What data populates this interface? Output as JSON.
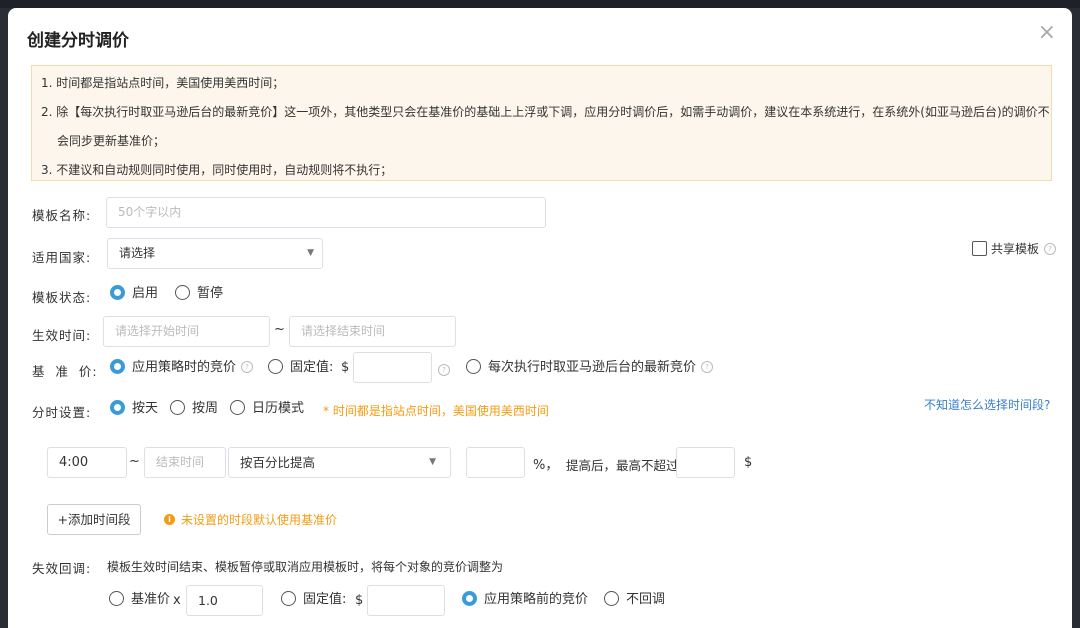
{
  "dialog": {
    "title": "创建分时调价",
    "close_icon": "×"
  },
  "notice": {
    "line1": "1. 时间都是指站点时间，美国使用美西时间；",
    "line2a": "2. 除【每次执行时取亚马逊后台的最新竞价】这一项外，其他类型只会在基准价的基础上上浮或下调，应用分时调价后，如需手动调价，建议在本系统进行，在系统外(如亚马逊后台)的调价不",
    "line2b": "会同步更新基准价；",
    "line3": "3. 不建议和自动规则同时使用，同时使用时，自动规则将不执行；"
  },
  "template_name": {
    "label": "模板名称:",
    "placeholder": "50个字以内"
  },
  "country": {
    "label": "适用国家:",
    "value": "请选择"
  },
  "share": {
    "label": "共享模板"
  },
  "status": {
    "label": "模板状态:",
    "options": [
      "启用",
      "暂停"
    ],
    "selected": 0
  },
  "effective_time": {
    "label": "生效时间:",
    "start_placeholder": "请选择开始时间",
    "separator": "~",
    "end_placeholder": "请选择结束时间"
  },
  "base_price": {
    "label": "基  准  价:",
    "opt_strategy": "应用策略时的竞价",
    "opt_fixed": "固定值:",
    "currency": "$",
    "opt_latest": "每次执行时取亚马逊后台的最新竞价"
  },
  "schedule": {
    "label": "分时设置:",
    "options": [
      "按天",
      "按周",
      "日历模式"
    ],
    "note": "* 时间都是指站点时间，美国使用美西时间",
    "help_link": "不知道怎么选择时间段?"
  },
  "segment": {
    "start_time": "4:00",
    "separator": "~",
    "end_placeholder": "结束时间",
    "mode": "按百分比提高",
    "percent_unit": "%，",
    "cap_label": "提高后，最高不超过",
    "currency": "$"
  },
  "add_segment": {
    "button": "+添加时间段",
    "hint": "未设置的时段默认使用基准价"
  },
  "fallback": {
    "label": "失效回调:",
    "description": "模板生效时间结束、模板暂停或取消应用模板时，将每个对象的竞价调整为",
    "opt_base": "基准价",
    "multiplier_sign": "x",
    "multiplier": "1.0",
    "opt_fixed": "固定值:",
    "currency": "$",
    "opt_before": "应用策略前的竞价",
    "opt_none": "不回调"
  },
  "colors": {
    "accent": "#3a9bd9",
    "warning": "#f39c12",
    "link": "#3a7fc9",
    "notice_bg": "#fdf6ec"
  }
}
